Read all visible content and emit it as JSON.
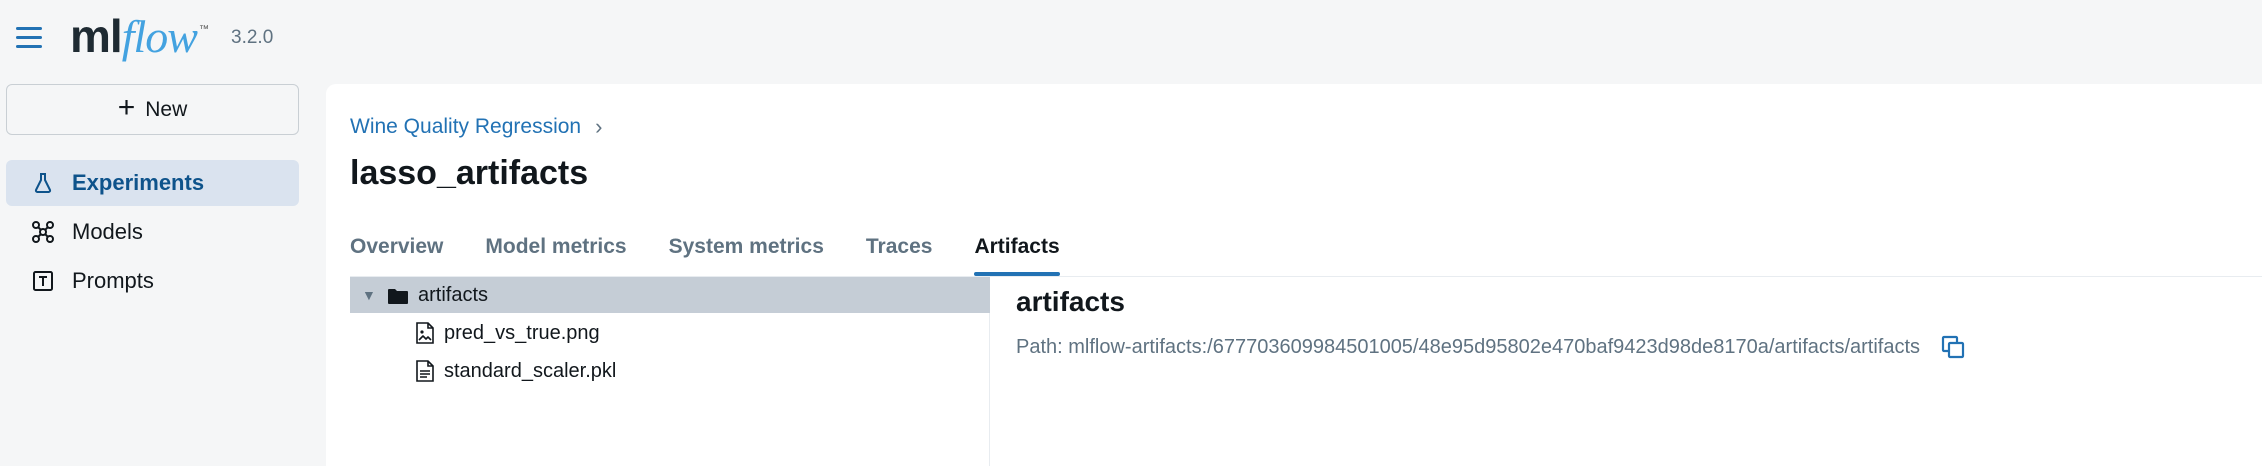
{
  "header": {
    "logo_ml": "ml",
    "logo_flow": "flow",
    "logo_tm": "™",
    "version": "3.2.0"
  },
  "sidebar": {
    "new_label": "New",
    "items": [
      {
        "label": "Experiments",
        "icon": "flask-icon",
        "active": true
      },
      {
        "label": "Models",
        "icon": "models-icon",
        "active": false
      },
      {
        "label": "Prompts",
        "icon": "prompts-icon",
        "active": false
      }
    ]
  },
  "main": {
    "breadcrumb": "Wine Quality Regression",
    "breadcrumb_sep": "›",
    "title": "lasso_artifacts",
    "tabs": [
      {
        "label": "Overview",
        "active": false
      },
      {
        "label": "Model metrics",
        "active": false
      },
      {
        "label": "System metrics",
        "active": false
      },
      {
        "label": "Traces",
        "active": false
      },
      {
        "label": "Artifacts",
        "active": true
      }
    ],
    "tree": {
      "folder": "artifacts",
      "files": [
        {
          "name": "pred_vs_true.png",
          "icon": "image-file-icon"
        },
        {
          "name": "standard_scaler.pkl",
          "icon": "text-file-icon"
        }
      ]
    },
    "detail": {
      "title": "artifacts",
      "path": "Path: mlflow-artifacts:/677703609984501005/48e95d95802e470baf9423d98de8170a/artifacts/artifacts"
    }
  },
  "colors": {
    "accent": "#2272b4",
    "logo_flow": "#43a2e0",
    "active_nav_bg": "#dae3ef",
    "tree_selected_bg": "#c5cdd6"
  }
}
